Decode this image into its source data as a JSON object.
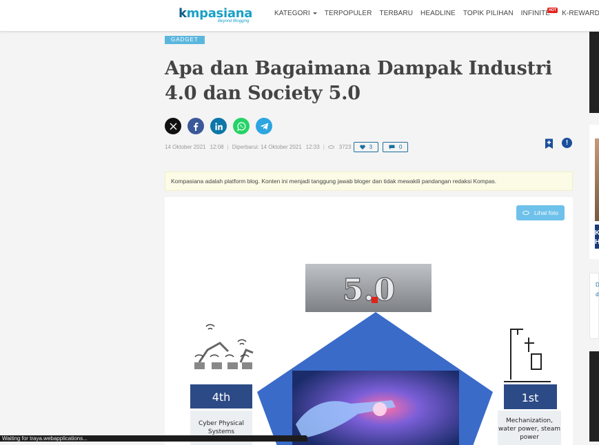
{
  "header": {
    "logo": {
      "prefix": "k",
      "rest": "mpasiana",
      "tagline": "Beyond Blogging"
    },
    "nav": [
      {
        "label": "KATEGORI",
        "dropdown": true
      },
      {
        "label": "TERPOPULER"
      },
      {
        "label": "TERBARU"
      },
      {
        "label": "HEADLINE"
      },
      {
        "label": "TOPIK PILIHAN"
      },
      {
        "label": "INFINITE",
        "badge": "HOT"
      },
      {
        "label": "K-REWARDS"
      }
    ]
  },
  "article": {
    "category": "GADGET",
    "title": "Apa dan Bagaimana Dampak Industri 4.0 dan Society 5.0",
    "share_icons": [
      "x-icon",
      "facebook-icon",
      "linkedin-icon",
      "whatsapp-icon",
      "telegram-icon"
    ],
    "meta": {
      "date": "14 Oktober 2021",
      "time": "12:08",
      "updated": "Diperbarui: 14 Oktober 2021",
      "updated_time": "12:33",
      "views": "3723",
      "likes": "3",
      "comments": "0"
    },
    "disclaimer": "Kompasiana adalah platform blog. Konten ini menjadi tanggung jawab bloger dan tidak mewakili pandangan redaksi Kompas.",
    "figure": {
      "view_button": "Lihat foto",
      "badge": "5.0",
      "left_label": "4th",
      "left_caption": [
        "Cyber Physical",
        "Systems"
      ],
      "right_label": "1st",
      "right_caption": [
        "Mechanization,",
        "water power, steam",
        "power"
      ]
    }
  },
  "sidebar": {
    "snippet_letters": [
      "K",
      "H"
    ],
    "snippet_text": [
      "D",
      "d"
    ]
  },
  "status": {
    "text": "Waiting for traya.webapplications..."
  },
  "colors": {
    "brand": "#19a0c6",
    "category": "#5bb6de",
    "accent": "#1a6fa0"
  }
}
